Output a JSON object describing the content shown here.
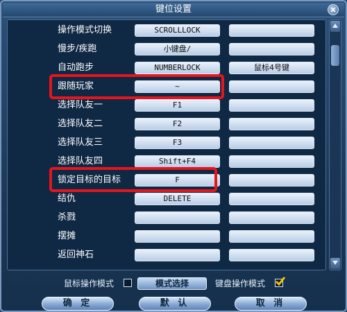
{
  "window": {
    "title": "键位设置"
  },
  "rows": [
    {
      "label": "操作模式切换",
      "key": "SCROLLLOCK",
      "alt_key": ""
    },
    {
      "label": "慢步/疾跑",
      "key": "小键盘/",
      "alt_key": ""
    },
    {
      "label": "自动跑步",
      "key": "NUMBERLOCK",
      "alt_key": "鼠标4号键"
    },
    {
      "label": "跟随玩家",
      "key": "~",
      "alt_key": ""
    },
    {
      "label": "选择队友一",
      "key": "F1",
      "alt_key": ""
    },
    {
      "label": "选择队友二",
      "key": "F2",
      "alt_key": ""
    },
    {
      "label": "选择队友三",
      "key": "F3",
      "alt_key": ""
    },
    {
      "label": "选择队友四",
      "key": "Shift+F4",
      "alt_key": ""
    },
    {
      "label": "锁定目标的目标",
      "key": "F",
      "alt_key": ""
    },
    {
      "label": "结仇",
      "key": "DELETE",
      "alt_key": ""
    },
    {
      "label": "杀戮",
      "key": "",
      "alt_key": ""
    },
    {
      "label": "摆摊",
      "key": "",
      "alt_key": ""
    },
    {
      "label": "返回神石",
      "key": "",
      "alt_key": ""
    }
  ],
  "mode": {
    "mouse_mode_label": "鼠标操作模式",
    "mouse_mode_checked": false,
    "select_button": "模式选择",
    "keyboard_mode_label": "键盘操作模式",
    "keyboard_mode_checked": true
  },
  "buttons": {
    "confirm": "确 定",
    "default": "默 认",
    "cancel": "取 消"
  },
  "colors": {
    "highlight": "#e8141b",
    "check_mark": "#f5c400",
    "panel": "#0f2844"
  }
}
